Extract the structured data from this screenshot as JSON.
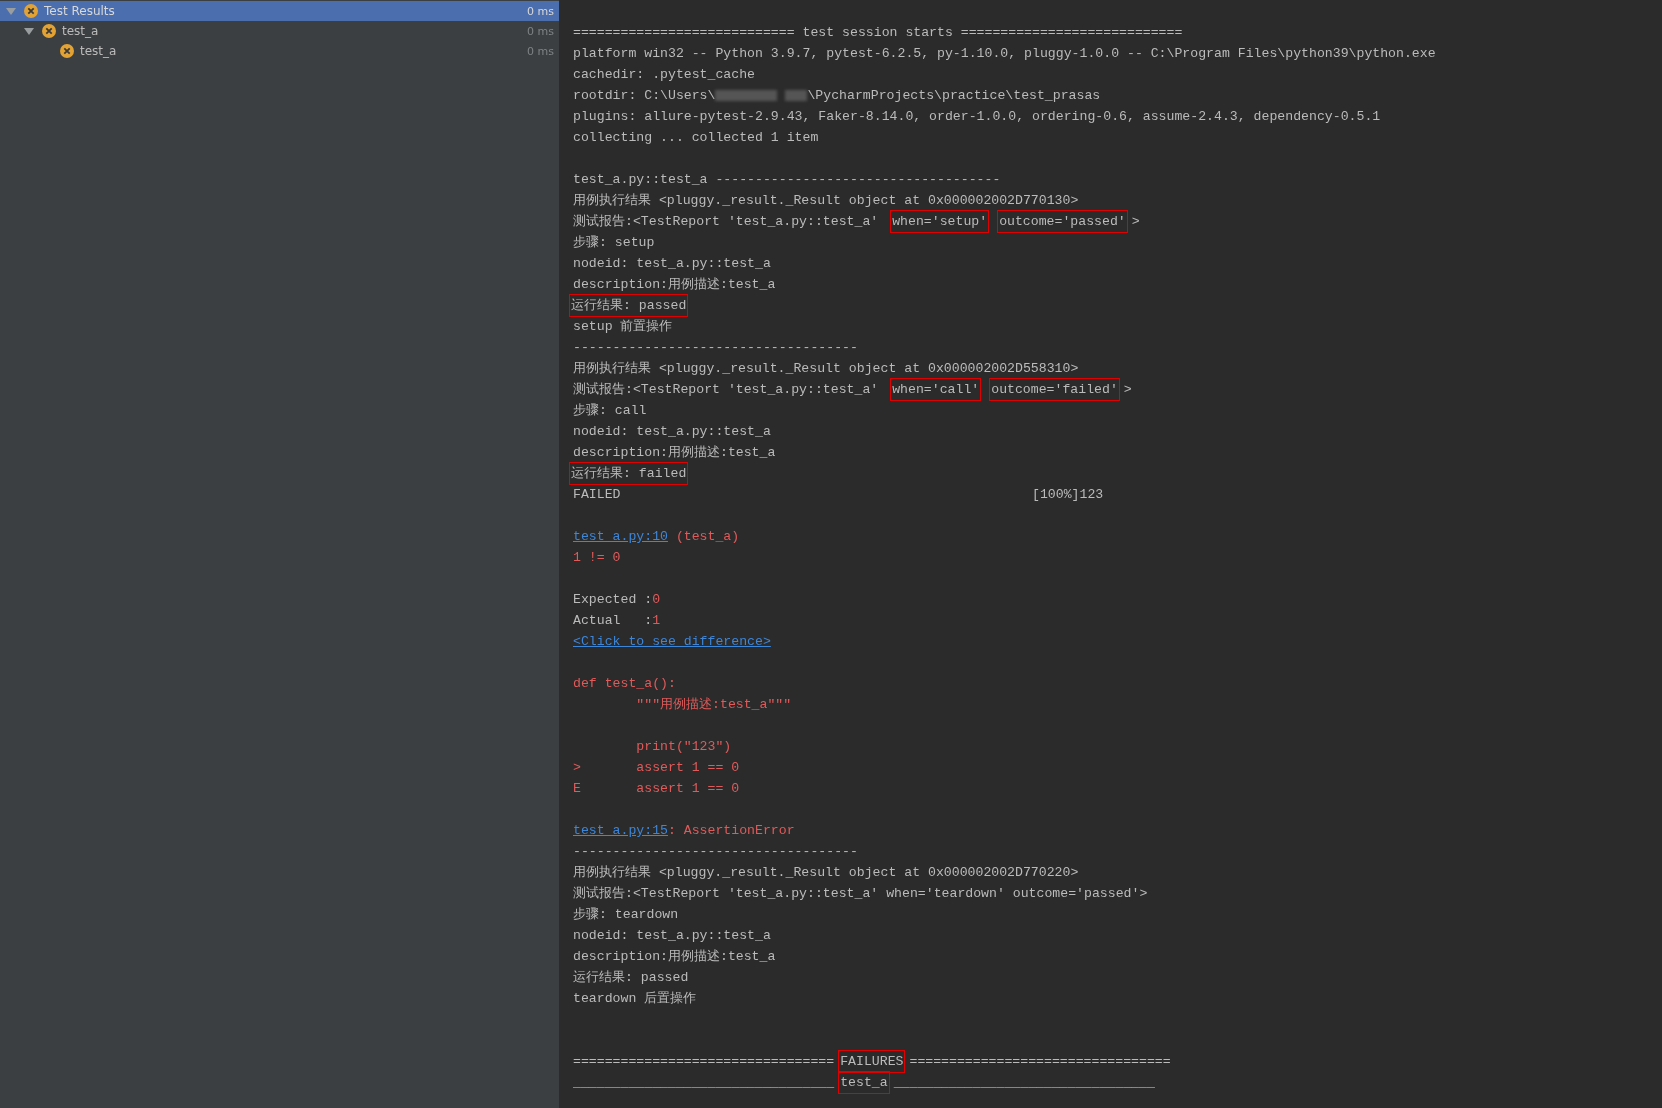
{
  "test_tree": [
    {
      "label": "Test Results",
      "time": "0 ms",
      "selected": true,
      "expanded": true,
      "children": [
        {
          "label": "test_a",
          "time": "0 ms",
          "selected": false,
          "expanded": true,
          "children": [
            {
              "label": "test_a",
              "time": "0 ms",
              "selected": false
            }
          ]
        }
      ]
    }
  ],
  "console": [
    {
      "kind": "text",
      "segments": [
        {
          "text": "============================ test session starts ============================",
          "kind": "plain"
        }
      ]
    },
    {
      "kind": "text",
      "segments": [
        {
          "text": "platform win32 -- Python 3.9.7, pytest-6.2.5, py-1.10.0, pluggy-1.0.0 -- C:\\Program Files\\python39\\python.exe",
          "kind": "plain"
        }
      ]
    },
    {
      "kind": "text",
      "segments": [
        {
          "text": "cachedir: .pytest_cache",
          "kind": "plain"
        }
      ]
    },
    {
      "kind": "text",
      "segments": [
        {
          "text": "rootdir: C:\\Users\\",
          "kind": "plain"
        },
        {
          "kind": "redacted"
        },
        {
          "text": "\\PycharmProjects\\practice\\test_prasas",
          "kind": "plain"
        }
      ]
    },
    {
      "kind": "text",
      "segments": [
        {
          "text": "plugins: allure-pytest-2.9.43, Faker-8.14.0, order-1.0.0, ordering-0.6, assume-2.4.3, dependency-0.5.1",
          "kind": "plain"
        }
      ]
    },
    {
      "kind": "text",
      "segments": [
        {
          "text": "collecting ... collected 1 item",
          "kind": "plain"
        }
      ]
    },
    {
      "kind": "blank"
    },
    {
      "kind": "text",
      "segments": [
        {
          "text": "test_a.py::test_a ------------------------------------",
          "kind": "plain"
        }
      ]
    },
    {
      "kind": "text",
      "segments": [
        {
          "text": "用例执行结果 <pluggy._result._Result object at 0x000002002D770130>",
          "kind": "plain"
        }
      ]
    },
    {
      "kind": "text",
      "segments": [
        {
          "text": "测试报告:<TestReport 'test_a.py::test_a' ",
          "kind": "plain"
        },
        {
          "text": "when='setup'",
          "kind": "plain",
          "boxed": true
        },
        {
          "text": "outcome='passed'",
          "kind": "plain",
          "boxed": true
        },
        {
          "text": ">",
          "kind": "plain"
        }
      ]
    },
    {
      "kind": "text",
      "segments": [
        {
          "text": "步骤: setup",
          "kind": "plain"
        }
      ]
    },
    {
      "kind": "text",
      "segments": [
        {
          "text": "nodeid: test_a.py::test_a",
          "kind": "plain"
        }
      ]
    },
    {
      "kind": "text",
      "segments": [
        {
          "text": "description:用例描述:test_a",
          "kind": "plain"
        }
      ]
    },
    {
      "kind": "text",
      "segments": [
        {
          "text": "运行结果: passed",
          "kind": "plain",
          "boxed": true
        }
      ]
    },
    {
      "kind": "text",
      "segments": [
        {
          "text": "setup 前置操作",
          "kind": "plain"
        }
      ]
    },
    {
      "kind": "text",
      "segments": [
        {
          "text": "------------------------------------",
          "kind": "plain"
        }
      ]
    },
    {
      "kind": "text",
      "segments": [
        {
          "text": "用例执行结果 <pluggy._result._Result object at 0x000002002D558310>",
          "kind": "plain"
        }
      ]
    },
    {
      "kind": "text",
      "segments": [
        {
          "text": "测试报告:<TestReport 'test_a.py::test_a' ",
          "kind": "plain"
        },
        {
          "text": "when='call'",
          "kind": "plain",
          "boxed": true
        },
        {
          "text": "outcome='failed'",
          "kind": "plain",
          "boxed": true
        },
        {
          "text": ">",
          "kind": "plain"
        }
      ]
    },
    {
      "kind": "text",
      "segments": [
        {
          "text": "步骤: call",
          "kind": "plain"
        }
      ]
    },
    {
      "kind": "text",
      "segments": [
        {
          "text": "nodeid: test_a.py::test_a",
          "kind": "plain"
        }
      ]
    },
    {
      "kind": "text",
      "segments": [
        {
          "text": "description:用例描述:test_a",
          "kind": "plain"
        }
      ]
    },
    {
      "kind": "text",
      "segments": [
        {
          "text": "运行结果: failed",
          "kind": "plain",
          "boxed": true
        }
      ]
    },
    {
      "kind": "text",
      "segments": [
        {
          "text": "FAILED                                                    [100%]123",
          "kind": "plain"
        }
      ]
    },
    {
      "kind": "blank"
    },
    {
      "kind": "text",
      "segments": [
        {
          "text": "test_a.py:10",
          "kind": "link"
        },
        {
          "text": " (test_a)",
          "kind": "error"
        }
      ]
    },
    {
      "kind": "text",
      "segments": [
        {
          "text": "1 != 0",
          "kind": "error"
        }
      ]
    },
    {
      "kind": "blank"
    },
    {
      "kind": "text",
      "segments": [
        {
          "text": "Expected :",
          "kind": "plain"
        },
        {
          "text": "0",
          "kind": "error"
        }
      ]
    },
    {
      "kind": "text",
      "segments": [
        {
          "text": "Actual   :",
          "kind": "plain"
        },
        {
          "text": "1",
          "kind": "error"
        }
      ]
    },
    {
      "kind": "text",
      "segments": [
        {
          "text": "<Click to see difference>",
          "kind": "link"
        }
      ]
    },
    {
      "kind": "blank"
    },
    {
      "kind": "text",
      "segments": [
        {
          "text": "def test_a():",
          "kind": "error"
        }
      ]
    },
    {
      "kind": "text",
      "segments": [
        {
          "text": "        \"\"\"用例描述:test_a\"\"\"",
          "kind": "error"
        }
      ]
    },
    {
      "kind": "blank"
    },
    {
      "kind": "text",
      "segments": [
        {
          "text": "        print(\"123\")",
          "kind": "error"
        }
      ]
    },
    {
      "kind": "text",
      "segments": [
        {
          "text": ">       assert 1 == 0",
          "kind": "error"
        }
      ]
    },
    {
      "kind": "text",
      "segments": [
        {
          "text": "E       assert 1 == 0",
          "kind": "error"
        }
      ]
    },
    {
      "kind": "blank"
    },
    {
      "kind": "text",
      "segments": [
        {
          "text": "test_a.py:15",
          "kind": "link"
        },
        {
          "text": ": AssertionError",
          "kind": "error"
        }
      ]
    },
    {
      "kind": "text",
      "segments": [
        {
          "text": "------------------------------------",
          "kind": "plain"
        }
      ]
    },
    {
      "kind": "text",
      "segments": [
        {
          "text": "用例执行结果 <pluggy._result._Result object at 0x000002002D770220>",
          "kind": "plain"
        }
      ]
    },
    {
      "kind": "text",
      "segments": [
        {
          "text": "测试报告:<TestReport 'test_a.py::test_a' when='teardown' outcome='passed'>",
          "kind": "plain"
        }
      ]
    },
    {
      "kind": "text",
      "segments": [
        {
          "text": "步骤: teardown",
          "kind": "plain"
        }
      ]
    },
    {
      "kind": "text",
      "segments": [
        {
          "text": "nodeid: test_a.py::test_a",
          "kind": "plain"
        }
      ]
    },
    {
      "kind": "text",
      "segments": [
        {
          "text": "description:用例描述:test_a",
          "kind": "plain"
        }
      ]
    },
    {
      "kind": "text",
      "segments": [
        {
          "text": "运行结果: passed",
          "kind": "plain"
        }
      ]
    },
    {
      "kind": "text",
      "segments": [
        {
          "text": "teardown 后置操作",
          "kind": "plain"
        }
      ]
    },
    {
      "kind": "blank"
    },
    {
      "kind": "blank"
    },
    {
      "kind": "text",
      "segments": [
        {
          "text": "=================================",
          "kind": "plain"
        },
        {
          "text": "FAILURES",
          "kind": "plain",
          "boxed": true
        },
        {
          "text": "=================================",
          "kind": "plain"
        }
      ]
    },
    {
      "kind": "text",
      "segments": [
        {
          "text": "_________________________________",
          "kind": "plain"
        },
        {
          "text": "test_a",
          "kind": "plain",
          "boxed": true
        },
        {
          "text": "_________________________________",
          "kind": "plain"
        }
      ]
    }
  ]
}
